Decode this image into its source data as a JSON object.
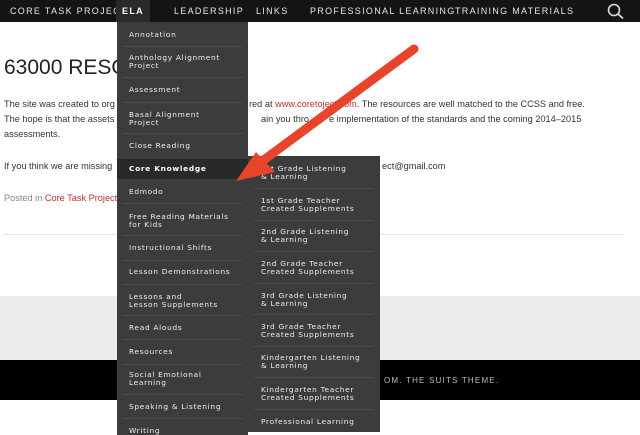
{
  "nav": {
    "items": [
      "CORE TASK PROJECT",
      "ELA",
      "LEADERSHIP",
      "LINKS",
      "PROFESSIONAL LEARNING",
      "TRAINING MATERIALS"
    ],
    "active": "ELA",
    "search_icon": "search-icon"
  },
  "article": {
    "title": "63000 RESO",
    "p1_a": "The site was created to org",
    "p1_b": "red at",
    "p1_link": "www.coret",
    "p1_link2": "oject.com",
    "p1_c": ". The resources  are well matched to the CCSS and free.",
    "p2_a": "The hope is that the assets",
    "p2_b": "ain you thro",
    "p2_c": "e implementation of the standards and  the coming 2014–2015",
    "p3": "assessments.",
    "p4_a": "If you think we are missing",
    "p4_b": "ect@gmail.com",
    "posted_a": "Posted in ",
    "posted_link": "Core Task Project"
  },
  "footer": {
    "text": "OM. THE SUITS THEME."
  },
  "ela_menu": [
    "Annotation",
    "Anthology Alignment\nProject",
    "Assessment",
    "Basal Alignment\nProject",
    "Close Reading",
    "Core Knowledge",
    "Edmodo",
    "Free Reading Materials\nfor Kids",
    "Instructional Shifts",
    "Lesson Demonstrations",
    "Lessons and\nLesson Supplements",
    "Read Alouds",
    "Resources",
    "Social Emotional\nLearning",
    "Speaking & Listening",
    "Writing"
  ],
  "ela_active": "Core Knowledge",
  "core_knowledge_menu": [
    "1st Grade Listening\n& Learning",
    "1st Grade Teacher\nCreated Supplements",
    "2nd Grade Listening\n& Learning",
    "2nd Grade Teacher\nCreated Supplements",
    "3rd Grade Listening\n& Learning",
    "3rd Grade Teacher\nCreated Supplements",
    "Kindergarten Listening\n& Learning",
    "Kindergarten Teacher\nCreated Supplements",
    "Professional Learning"
  ],
  "colors": {
    "nav_bg": "#141414",
    "menu_bg": "#3c3c3c",
    "arrow": "#e8432b",
    "link": "#b5332a"
  }
}
